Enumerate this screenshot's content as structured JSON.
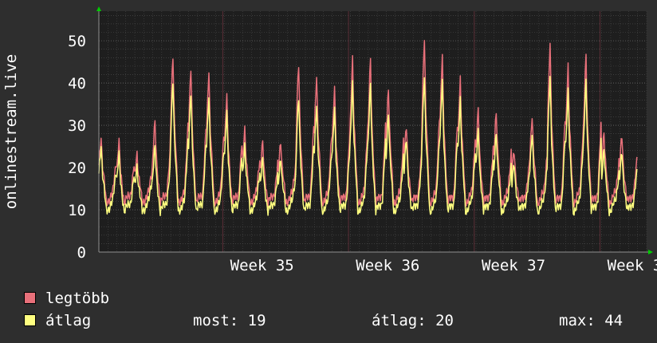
{
  "chart_data": {
    "type": "line",
    "ylabel": "onlinestream.live",
    "ylim": [
      0,
      57
    ],
    "y_ticks": [
      0,
      10,
      20,
      30,
      40,
      50
    ],
    "x_ticks": [
      {
        "label": "Week 35",
        "day": 7
      },
      {
        "label": "Week 36",
        "day": 14
      },
      {
        "label": "Week 37",
        "day": 21
      },
      {
        "label": "Week 38",
        "day": 28
      }
    ],
    "x_range_days": [
      0,
      30.5
    ],
    "grid": true,
    "colors": {
      "background": "#2e2e2e",
      "plot_background": "#1e1e1e",
      "grid": "#505050",
      "vline": "#5a2e36",
      "axis": "#909090",
      "arrow": "#00cc00",
      "max_series": "#e8707a",
      "avg_series": "#ffff80"
    },
    "series": [
      {
        "name": "legtöbb",
        "color": "#e8707a",
        "daily_peaks": [
          28,
          26,
          24,
          31,
          48,
          44,
          44,
          37,
          30,
          26,
          27,
          45,
          43,
          39,
          47,
          46,
          40,
          30,
          52,
          47,
          42,
          34,
          34,
          24,
          33,
          50,
          45,
          47,
          29,
          28
        ]
      },
      {
        "name": "átlag",
        "color": "#ffff80",
        "daily_peaks": [
          26,
          23,
          21,
          25,
          42,
          38,
          38,
          33,
          26,
          22,
          23,
          37,
          36,
          34,
          41,
          40,
          34,
          27,
          43,
          41,
          37,
          29,
          29,
          21,
          29,
          42,
          39,
          41,
          25,
          24
        ]
      }
    ]
  },
  "legend": {
    "items": [
      {
        "label": "legtöbb",
        "color": "#e8707a"
      },
      {
        "label": "átlag",
        "color": "#ffff80"
      }
    ],
    "stats": {
      "current": "most: 19",
      "average": "átlag: 20",
      "max": "max: 44"
    }
  }
}
